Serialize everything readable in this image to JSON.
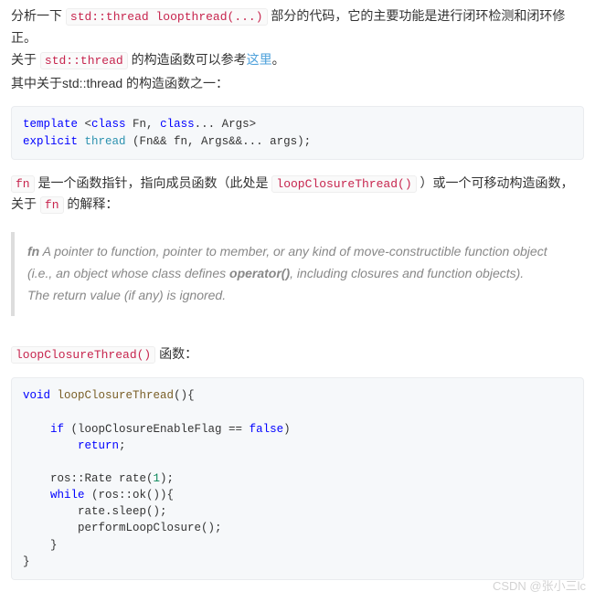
{
  "para1": {
    "pre": "分析一下 ",
    "code": "std::thread loopthread(...)",
    "post": " 部分的代码，它的主要功能是进行闭环检测和闭环修正。"
  },
  "para2": {
    "pre": "关于 ",
    "code": "std::thread",
    "mid": " 的构造函数可以参考",
    "link": "这里",
    "post": "。"
  },
  "para3": "其中关于std::thread 的构造函数之一：",
  "codeblock1": {
    "l1a": "template",
    "l1b": " <",
    "l1c": "class",
    "l1d": " Fn, ",
    "l1e": "class",
    "l1f": "... Args>",
    "l2a": "explicit",
    "l2b": " ",
    "l2c": "thread",
    "l2d": " (Fn&& fn, Args&&... args);"
  },
  "para4": {
    "code1": "fn",
    "t1": " 是一个函数指针，指向成员函数（此处是 ",
    "code2": "loopClosureThread()",
    "t2": " ）或一个可移动构造函数，关于 ",
    "code3": "fn",
    "t3": " 的解释："
  },
  "quote": {
    "s1": "fn",
    "s2": " A pointer to function, pointer to member, or any kind of move-constructible function object (i.e., an object whose class defines ",
    "s3": "operator()",
    "s4": ", including closures and function objects).",
    "s5": "The return value (if any) is ignored."
  },
  "para5": {
    "code": "loopClosureThread()",
    "post": " 函数："
  },
  "codeblock2": {
    "k_void": "void",
    "fn": "loopClosureThread",
    "l1_tail": "(){",
    "k_if": "if",
    "l3_mid": " (loopClosureEnableFlag == ",
    "k_false": "false",
    "l3_tail": ")",
    "k_return": "return",
    "l4_tail": ";",
    "l6": "    ros::Rate rate(",
    "n1": "1",
    "l6_tail": ");",
    "k_while": "while",
    "l7_mid": " (ros::ok()){",
    "l8": "        rate.sleep();",
    "l9": "        performLoopClosure();",
    "l10": "    }",
    "l11": "}"
  },
  "watermark": "CSDN @张小三lc"
}
